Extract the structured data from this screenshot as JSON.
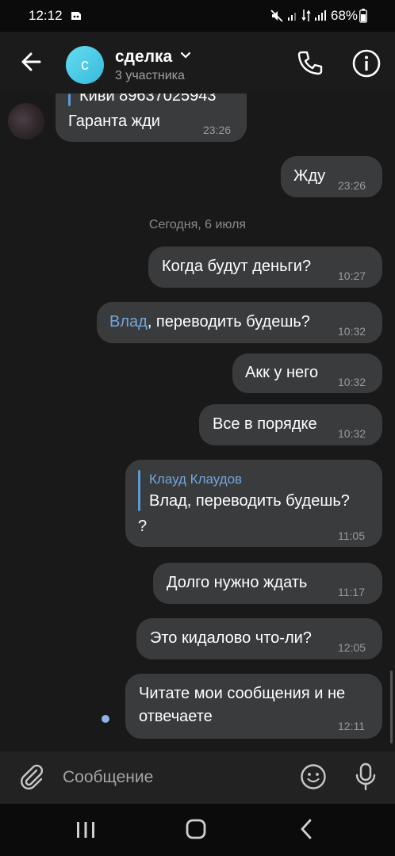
{
  "status_bar": {
    "time": "12:12",
    "battery": "68%"
  },
  "header": {
    "avatar_letter": "с",
    "title": "сделка",
    "subtitle": "3 участника",
    "icons": {
      "back": "arrow-left-icon",
      "call": "phone-icon",
      "info": "info-icon",
      "chevron": "chevron-down-icon"
    }
  },
  "messages": {
    "first": {
      "quote_partial": "Киви 89637025943",
      "text": "Гаранта жди",
      "time": "23:26"
    },
    "m1": {
      "text": "Жду",
      "time": "23:26"
    },
    "date_separator": "Сегодня, 6 июля",
    "m2": {
      "text": "Когда будут деньги?",
      "time": "10:27"
    },
    "m3": {
      "mention": "Влад",
      "text": ", переводить будешь?",
      "time": "10:32"
    },
    "m4": {
      "text": "Акк у него",
      "time": "10:32"
    },
    "m5": {
      "text": "Все в порядке",
      "time": "10:32"
    },
    "m6": {
      "quote_author": "Клауд Клаудов",
      "quote_text": "Влад, переводить будешь?",
      "text": "?",
      "time": "11:05"
    },
    "m7": {
      "text": "Долго нужно ждать",
      "time": "11:17"
    },
    "m8": {
      "text": "Это кидалово что-ли?",
      "time": "12:05"
    },
    "m9": {
      "line1": "Читате мои сообщения и не",
      "line2": "отвечаете",
      "time": "12:11"
    }
  },
  "composer": {
    "placeholder": "Сообщение",
    "icons": {
      "attach": "paperclip-icon",
      "emoji": "smiley-icon",
      "mic": "microphone-icon"
    }
  },
  "navbar": {
    "icons": {
      "recents": "recents-icon",
      "home": "home-icon",
      "back": "back-chevron-icon"
    }
  },
  "colors": {
    "background": "#191919",
    "bubble": "#3a3b3c",
    "accent": "#71a7e0",
    "avatar": "#4ccbe6"
  }
}
